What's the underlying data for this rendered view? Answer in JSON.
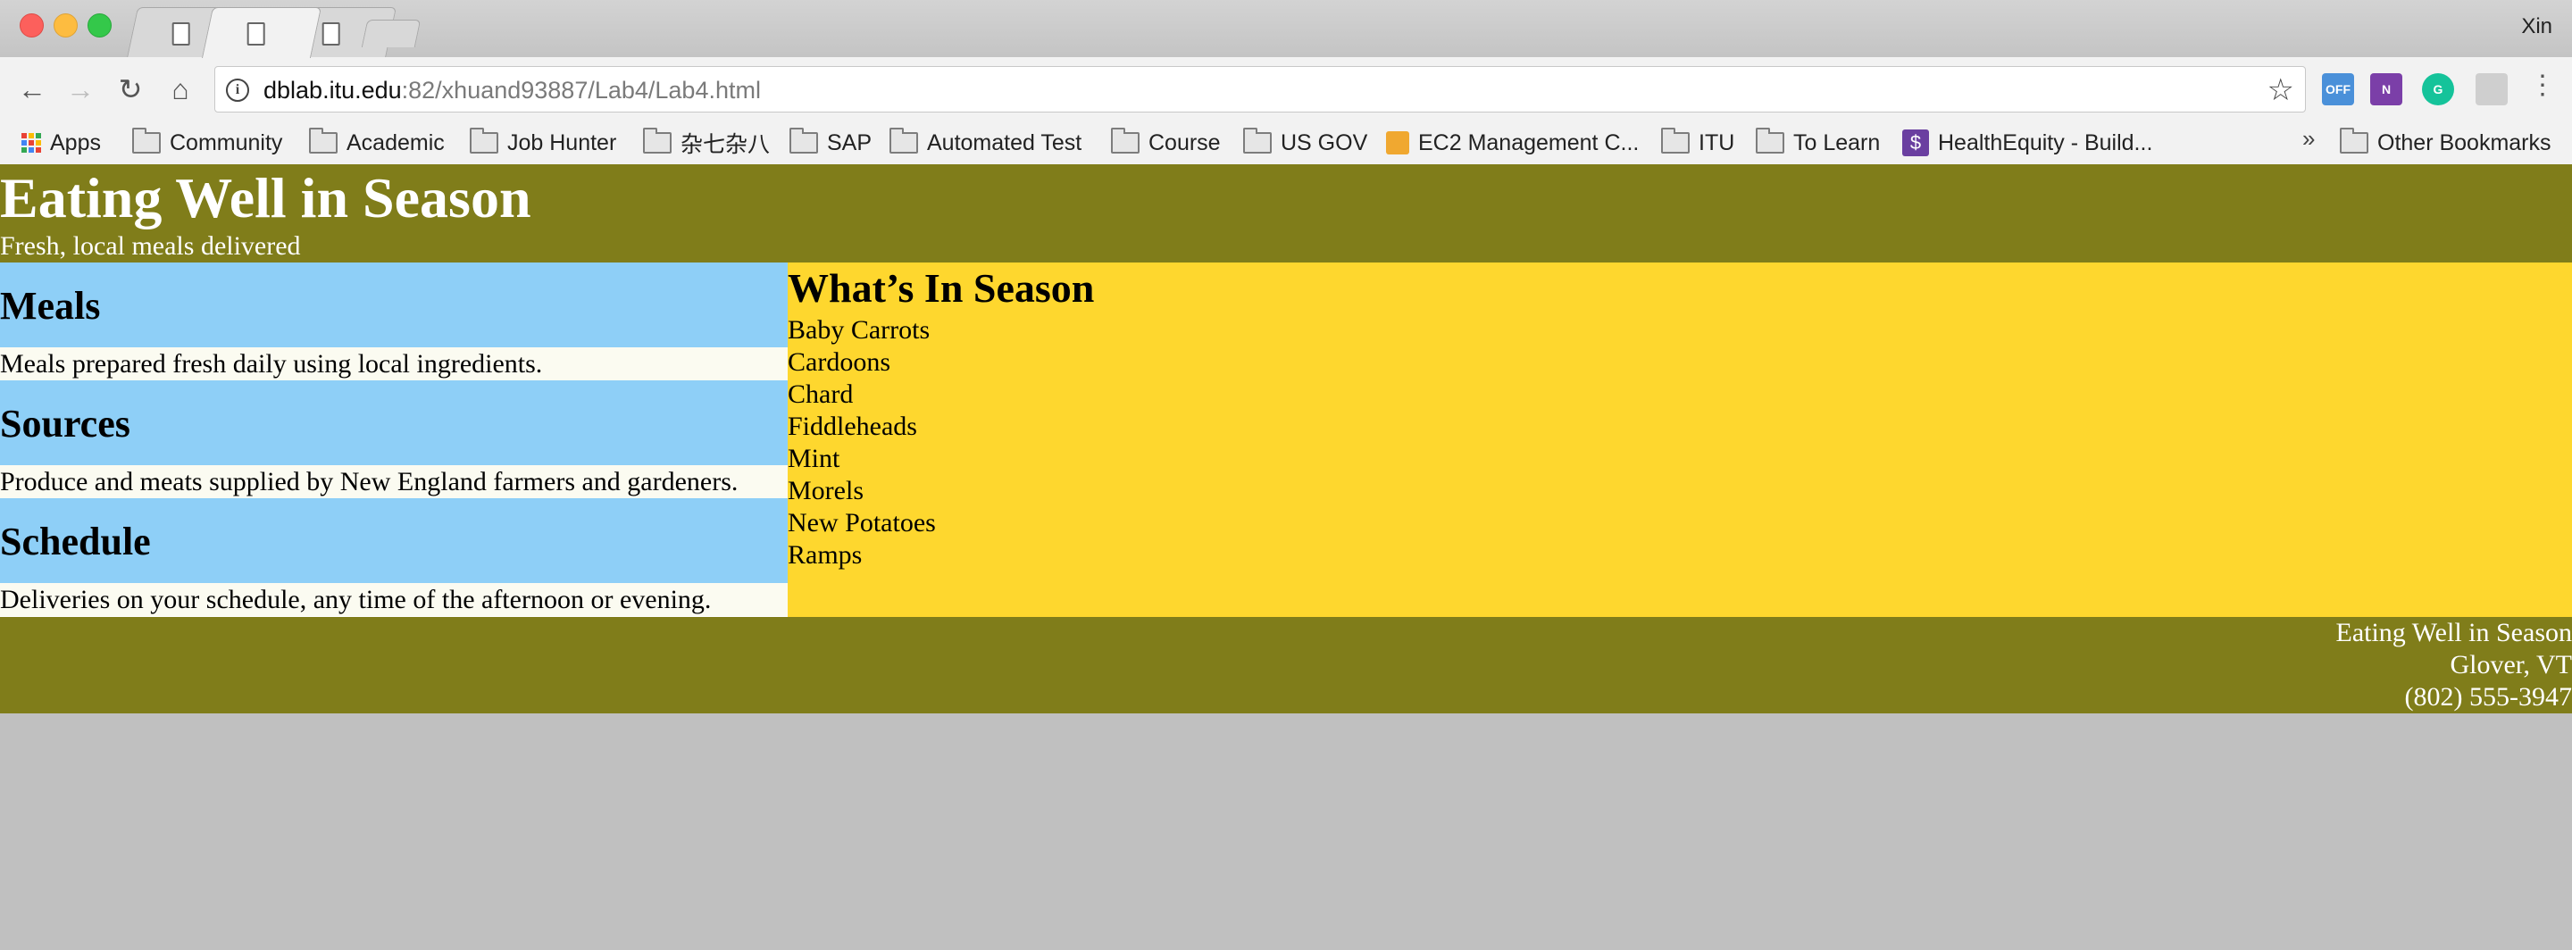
{
  "browser": {
    "profile_name": "Xin",
    "url_host": "dblab.itu.edu",
    "url_rest": ":82/xhuand93887/Lab4/Lab4.html",
    "bookmarks": [
      {
        "label": "Apps",
        "icon": "apps-grid-icon"
      },
      {
        "label": "Community",
        "icon": "folder-icon"
      },
      {
        "label": "Academic",
        "icon": "folder-icon"
      },
      {
        "label": "Job Hunter",
        "icon": "folder-icon"
      },
      {
        "label": "杂七杂八",
        "icon": "folder-icon"
      },
      {
        "label": "SAP",
        "icon": "folder-icon"
      },
      {
        "label": "Automated Test",
        "icon": "folder-icon"
      },
      {
        "label": "Course",
        "icon": "folder-icon"
      },
      {
        "label": "US GOV",
        "icon": "folder-icon"
      },
      {
        "label": "EC2 Management C...",
        "icon": "box-icon"
      },
      {
        "label": "ITU",
        "icon": "folder-icon"
      },
      {
        "label": "To Learn",
        "icon": "folder-icon"
      },
      {
        "label": "HealthEquity - Build...",
        "icon": "healthequity-icon"
      }
    ],
    "overflow_label": "»",
    "other_bookmarks": "Other Bookmarks",
    "extensions": {
      "ext1": "OFF",
      "ext2": "N",
      "ext3": "G"
    }
  },
  "site": {
    "title": "Eating Well in Season",
    "tagline": "Fresh, local meals delivered",
    "sections": [
      {
        "heading": "Meals",
        "text": "Meals prepared fresh daily using local ingredients."
      },
      {
        "heading": "Sources",
        "text": "Produce and meats supplied by New England farmers and gardeners."
      },
      {
        "heading": "Schedule",
        "text": "Deliveries on your schedule, any time of the afternoon or evening."
      }
    ],
    "in_season": {
      "heading": "What’s In Season",
      "items": [
        "Baby Carrots",
        "Cardoons",
        "Chard",
        "Fiddleheads",
        "Mint",
        "Morels",
        "New Potatoes",
        "Ramps"
      ]
    },
    "footer": {
      "name": "Eating Well in Season",
      "location": "Glover, VT",
      "phone": "(802) 555-3947"
    }
  },
  "colors": {
    "header_footer": "#807d1a",
    "section_heading": "#8ecff7",
    "in_season_bg": "#fed72e",
    "browser_bg": "#c0c0c0"
  }
}
